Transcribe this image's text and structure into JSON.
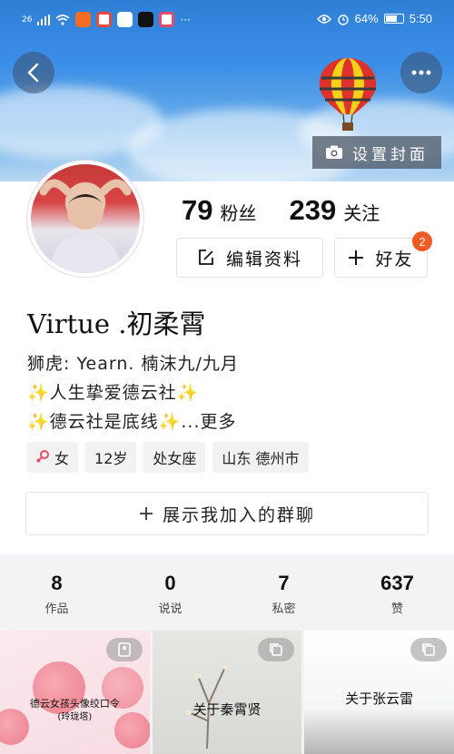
{
  "status_bar": {
    "carrier": "26",
    "battery": "64%",
    "time": "5:50",
    "more": "···"
  },
  "header": {
    "cover_button_label": "设置封面",
    "accent_color": "#f15a22"
  },
  "profile": {
    "followers_count": "79",
    "followers_label": "粉丝",
    "following_count": "239",
    "following_label": "关注",
    "edit_label": "编辑资料",
    "add_friend_label": "好友",
    "friend_badge": "2",
    "name": "Virtue .初柔霄",
    "bio_lines": [
      "狮虎: Yearn. 楠沫九/九月",
      "人生挚爱德云社",
      "德云社是底线",
      "...更多"
    ],
    "tags": [
      "女",
      "12岁",
      "处女座",
      "山东 德州市"
    ],
    "group_button_label": "展示我加入的群聊"
  },
  "stats": [
    {
      "value": "8",
      "label": "作品"
    },
    {
      "value": "0",
      "label": "说说"
    },
    {
      "value": "7",
      "label": "私密"
    },
    {
      "value": "637",
      "label": "赞"
    }
  ],
  "posts": [
    {
      "text": "德云女孩头像绞口令",
      "subtext": "(玲珑塔)",
      "icon": "image-icon"
    },
    {
      "text": "关于秦霄贤",
      "icon": "copy-icon"
    },
    {
      "text": "关于张云雷",
      "icon": "copy-icon"
    }
  ]
}
